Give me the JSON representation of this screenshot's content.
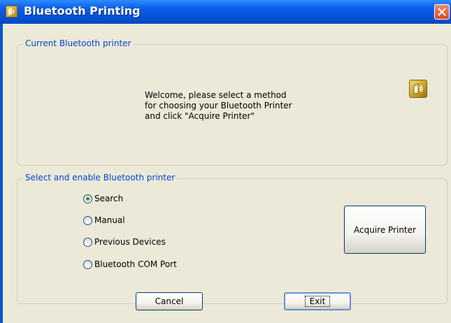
{
  "window": {
    "title": "Bluetooth Printing"
  },
  "current_group": {
    "legend": "Current Bluetooth printer",
    "welcome_lines": [
      "Welcome, please select a method",
      "for choosing your Bluetooth Printer",
      "and click \"Acquire Printer\""
    ]
  },
  "select_group": {
    "legend": "Select and enable Bluetooth printer",
    "options": [
      {
        "label": "Search",
        "checked": true
      },
      {
        "label": "Manual",
        "checked": false
      },
      {
        "label": "Previous Devices",
        "checked": false
      },
      {
        "label": "Bluetooth COM Port",
        "checked": false
      }
    ],
    "acquire_label": "Acquire Printer"
  },
  "footer": {
    "cancel_label": "Cancel",
    "exit_label": "Exit"
  },
  "colors": {
    "titlebar": "#0a5fe8",
    "legend_text": "#0046d5",
    "client_bg": "#ece9d8",
    "close_button": "#d84a22"
  }
}
